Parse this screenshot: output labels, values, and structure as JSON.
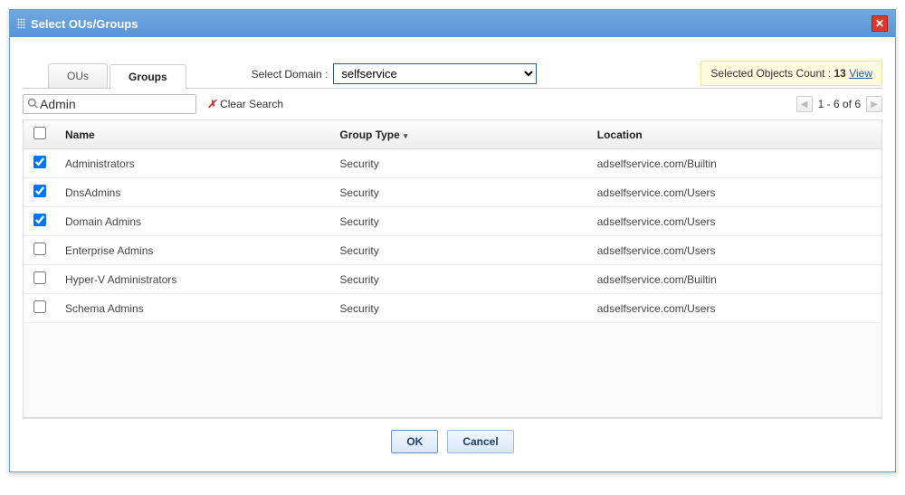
{
  "dialog": {
    "title": "Select OUs/Groups"
  },
  "tabs": {
    "ous": "OUs",
    "groups": "Groups"
  },
  "domain": {
    "label": "Select Domain :",
    "value": "selfservice"
  },
  "selected_badge": {
    "prefix": "Selected Objects Count : ",
    "count": "13",
    "view": "View"
  },
  "search": {
    "value": "Admin",
    "clear_label": "Clear Search"
  },
  "pager": {
    "text": "1 - 6 of 6"
  },
  "table": {
    "headers": {
      "name": "Name",
      "type": "Group Type",
      "location": "Location"
    },
    "rows": [
      {
        "checked": true,
        "name": "Administrators",
        "type": "Security",
        "location": "adselfservice.com/Builtin"
      },
      {
        "checked": true,
        "name": "DnsAdmins",
        "type": "Security",
        "location": "adselfservice.com/Users"
      },
      {
        "checked": true,
        "name": "Domain Admins",
        "type": "Security",
        "location": "adselfservice.com/Users"
      },
      {
        "checked": false,
        "name": "Enterprise Admins",
        "type": "Security",
        "location": "adselfservice.com/Users"
      },
      {
        "checked": false,
        "name": "Hyper-V Administrators",
        "type": "Security",
        "location": "adselfservice.com/Builtin"
      },
      {
        "checked": false,
        "name": "Schema Admins",
        "type": "Security",
        "location": "adselfservice.com/Users"
      }
    ]
  },
  "footer": {
    "ok": "OK",
    "cancel": "Cancel"
  }
}
